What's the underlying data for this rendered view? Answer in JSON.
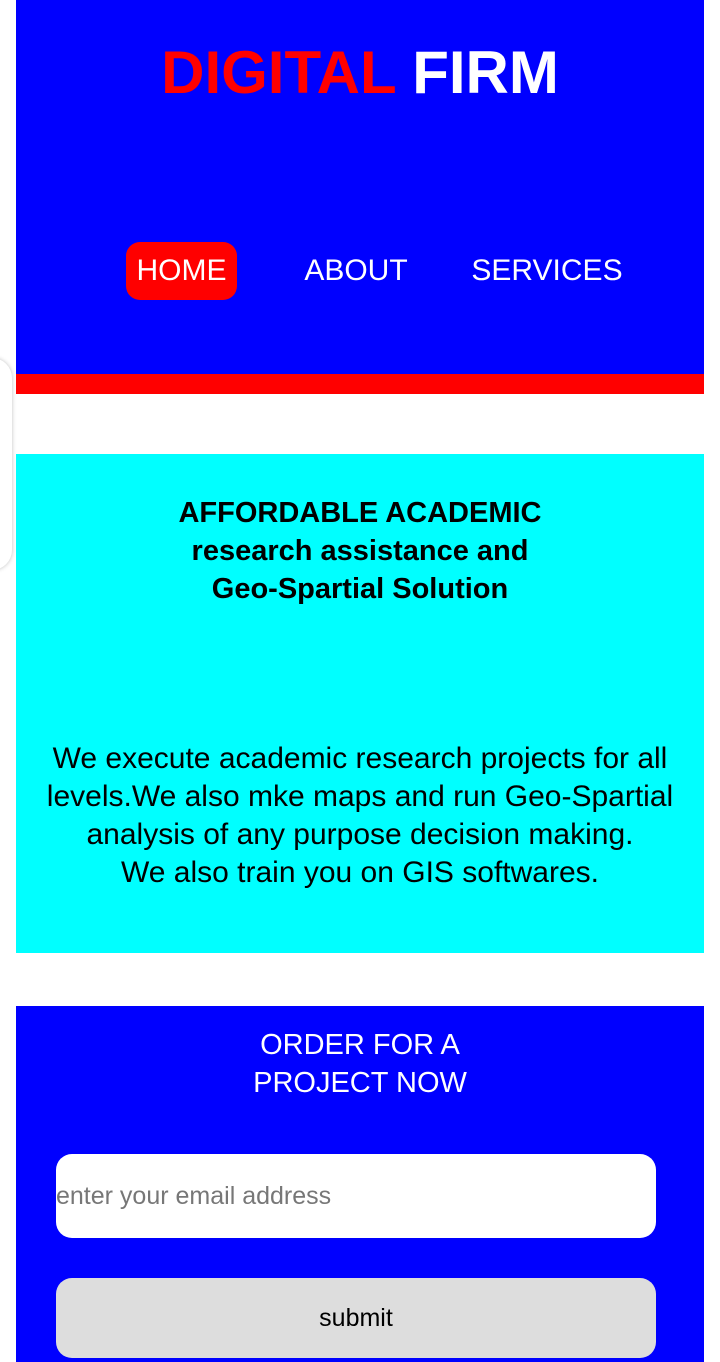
{
  "brand": {
    "word1": "DIGITAL",
    "word2": "FIRM",
    "word1_color": "#ff0000",
    "word2_color": "#ffffff"
  },
  "nav": {
    "items": [
      {
        "label": "HOME",
        "active": true
      },
      {
        "label": "ABOUT",
        "active": false
      },
      {
        "label": "SERVICES",
        "active": false
      }
    ]
  },
  "hero": {
    "title_lines": [
      "AFFORDABLE ACADEMIC",
      "research assistance and",
      "Geo-Spartial Solution"
    ],
    "text_lines": [
      "We execute academic research projects for all",
      "levels.We also mke maps and run Geo-Spartial",
      "analysis of any purpose decision making.",
      "We also train you on GIS softwares."
    ]
  },
  "order": {
    "title_lines": [
      "ORDER FOR A",
      "PROJECT NOW"
    ],
    "email_placeholder": "enter your email address",
    "email_value": "",
    "submit_label": "submit"
  },
  "colors": {
    "header_bg": "#0000ff",
    "stripe": "#ff0000",
    "active_nav": "#ff0000",
    "hero_bg": "#00ffff",
    "order_bg": "#0000ff",
    "submit_bg": "#dddddd"
  }
}
